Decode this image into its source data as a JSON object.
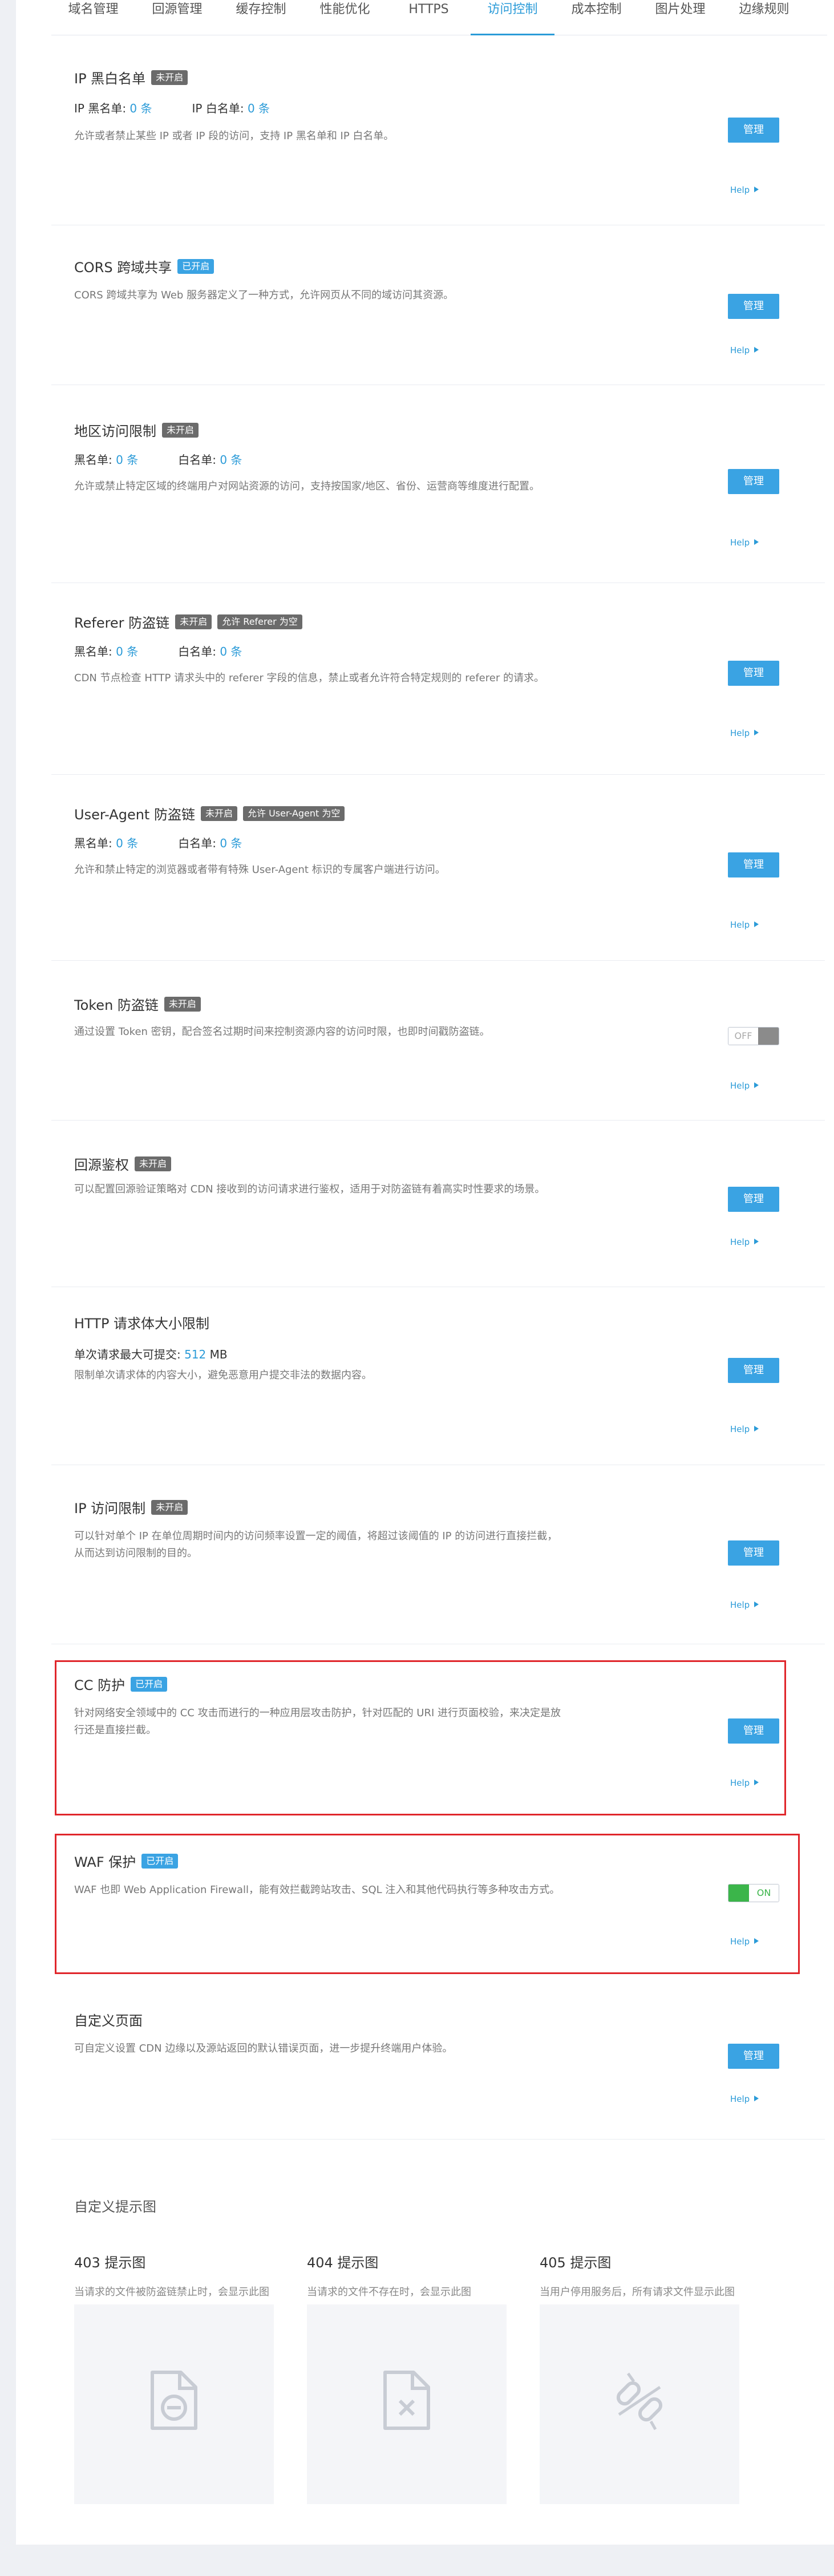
{
  "tabs": [
    "域名管理",
    "回源管理",
    "缓存控制",
    "性能优化",
    "HTTPS",
    "访问控制",
    "成本控制",
    "图片处理",
    "边缘规则"
  ],
  "active_tab": "访问控制",
  "common": {
    "manage": "管理",
    "help": "Help"
  },
  "sections": {
    "ip_list": {
      "title": "IP 黑白名单",
      "badge": "未开启",
      "stat1_label": "IP 黑名单:",
      "stat1_value": "0 条",
      "stat2_label": "IP 白名单:",
      "stat2_value": "0 条",
      "desc": "允许或者禁止某些 IP 或者 IP 段的访问，支持 IP 黑名单和 IP 白名单。"
    },
    "cors": {
      "title": "CORS 跨域共享",
      "badge": "已开启",
      "desc": "CORS 跨域共享为 Web 服务器定义了一种方式，允许网页从不同的域访问其资源。"
    },
    "region": {
      "title": "地区访问限制",
      "badge": "未开启",
      "stat1_label": "黑名单:",
      "stat1_value": "0 条",
      "stat2_label": "白名单:",
      "stat2_value": "0 条",
      "desc": "允许或禁止特定区域的终端用户对网站资源的访问，支持按国家/地区、省份、运营商等维度进行配置。"
    },
    "referer": {
      "title": "Referer 防盗链",
      "badge": "未开启",
      "badge2": "允许 Referer 为空",
      "stat1_label": "黑名单:",
      "stat1_value": "0 条",
      "stat2_label": "白名单:",
      "stat2_value": "0 条",
      "desc": "CDN 节点检查 HTTP 请求头中的 referer 字段的信息，禁止或者允许符合特定规则的 referer 的请求。"
    },
    "ua": {
      "title": "User-Agent 防盗链",
      "badge": "未开启",
      "badge2": "允许 User-Agent 为空",
      "stat1_label": "黑名单:",
      "stat1_value": "0 条",
      "stat2_label": "白名单:",
      "stat2_value": "0 条",
      "desc": "允许和禁止特定的浏览器或者带有特殊 User-Agent 标识的专属客户端进行访问。"
    },
    "token": {
      "title": "Token 防盗链",
      "badge": "未开启",
      "desc": "通过设置 Token 密钥，配合签名过期时间来控制资源内容的访问时限，也即时间戳防盗链。",
      "toggle": "OFF"
    },
    "origin_auth": {
      "title": "回源鉴权",
      "badge": "未开启",
      "desc": "可以配置回源验证策略对 CDN 接收到的访问请求进行鉴权，适用于对防盗链有着高实时性要求的场景。"
    },
    "body_limit": {
      "title": "HTTP 请求体大小限制",
      "stat_label": "单次请求最大可提交:",
      "stat_value": "512",
      "stat_unit": "MB",
      "desc": "限制单次请求体的内容大小，避免恶意用户提交非法的数据内容。"
    },
    "ip_rate": {
      "title": "IP 访问限制",
      "badge": "未开启",
      "desc": "可以针对单个 IP 在单位周期时间内的访问频率设置一定的阈值，将超过该阈值的 IP 的访问进行直接拦截，从而达到访问限制的目的。"
    },
    "cc": {
      "title": "CC 防护",
      "badge": "已开启",
      "desc": "针对网络安全领域中的 CC 攻击而进行的一种应用层攻击防护，针对匹配的 URI 进行页面校验，来决定是放行还是直接拦截。"
    },
    "waf": {
      "title": "WAF 保护",
      "badge": "已开启",
      "desc": "WAF 也即 Web Application Firewall，能有效拦截跨站攻击、SQL 注入和其他代码执行等多种攻击方式。",
      "toggle": "ON"
    },
    "custom_page": {
      "title": "自定义页面",
      "desc": "可自定义设置 CDN 边缘以及源站返回的默认错误页面，进一步提升终端用户体验。"
    }
  },
  "tips": {
    "title": "自定义提示图",
    "items": [
      {
        "title": "403 提示图",
        "desc": "当请求的文件被防盗链禁止时，会显示此图",
        "icon": "file-minus-icon"
      },
      {
        "title": "404 提示图",
        "desc": "当请求的文件不存在时，会显示此图",
        "icon": "file-x-icon"
      },
      {
        "title": "405 提示图",
        "desc": "当用户停用服务后，所有请求文件显示此图",
        "icon": "broken-link-icon"
      }
    ]
  },
  "colors": {
    "accent": "#3aa3e3",
    "badge_off": "#6b6b6b",
    "highlight": "#e0262b",
    "toggle_on": "#3bb54a"
  }
}
